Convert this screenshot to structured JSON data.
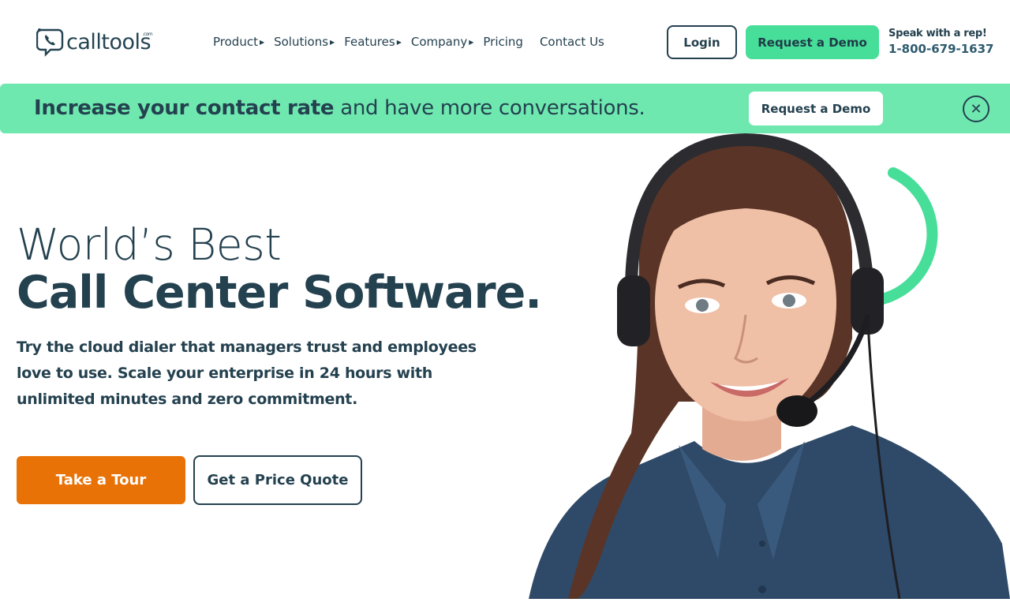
{
  "brand": {
    "logo_text": "calltools",
    "logo_suffix": ".com",
    "colors": {
      "navy": "#24414f",
      "green": "#47de99",
      "banner": "#6fe8b0",
      "orange": "#e97206"
    }
  },
  "nav": {
    "items": [
      {
        "label": "Product",
        "has_submenu": true
      },
      {
        "label": "Solutions",
        "has_submenu": true
      },
      {
        "label": "Features",
        "has_submenu": true
      },
      {
        "label": "Company",
        "has_submenu": true
      },
      {
        "label": "Pricing",
        "has_submenu": false
      },
      {
        "label": "Contact Us",
        "has_submenu": false
      }
    ],
    "login_label": "Login",
    "demo_label": "Request a Demo",
    "rep_label": "Speak with a rep!",
    "rep_phone": "1-800-679-1637"
  },
  "banner": {
    "bold_text": "Increase your contact rate",
    "rest_text": " and have more conversations.",
    "button_label": "Request a Demo",
    "close_icon": "close-circle-icon"
  },
  "hero": {
    "title_line1": "World’s Best",
    "title_line2": "Call Center Software.",
    "subtitle": "Try the cloud dialer that managers trust and employees love to use. Scale your enterprise in 24 hours with unlimited minutes and zero commitment.",
    "primary_button": "Take a Tour",
    "secondary_button": "Get a Price Quote",
    "image": "call-center-agent-with-headset-photo"
  }
}
